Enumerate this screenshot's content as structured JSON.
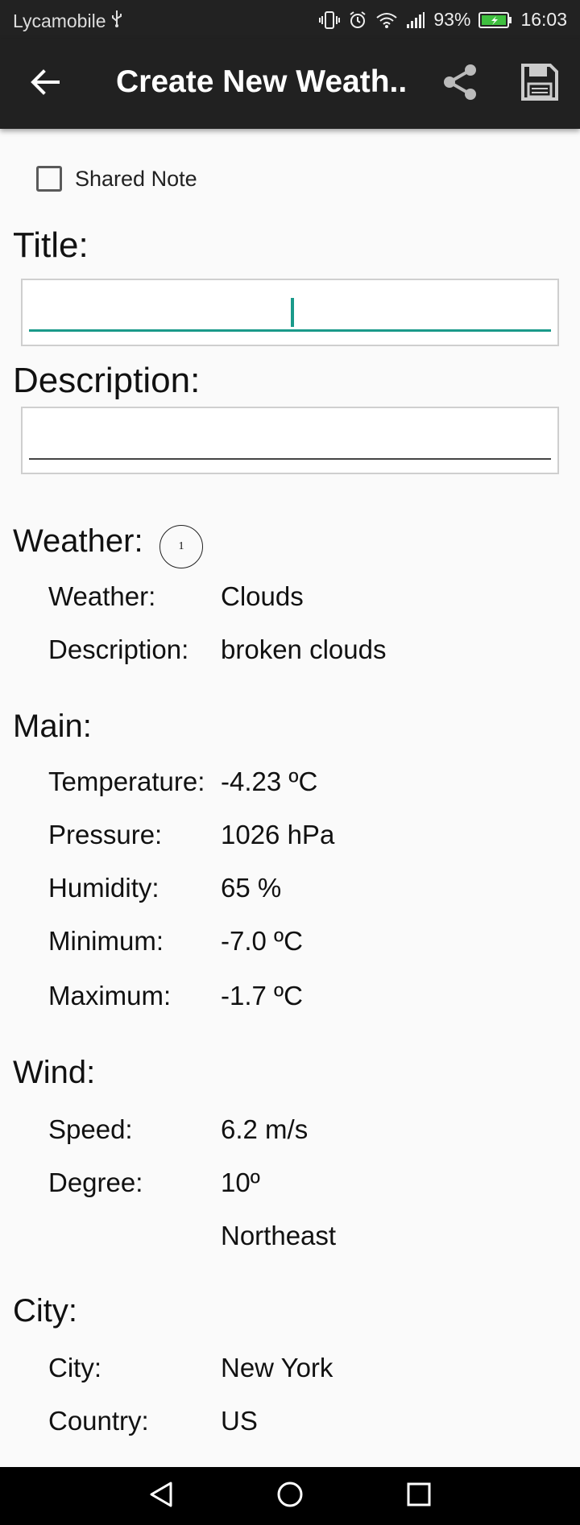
{
  "status_bar": {
    "carrier": "Lycamobile",
    "battery": "93%",
    "time": "16:03"
  },
  "app_bar": {
    "title": "Create New Weath...",
    "icons": [
      "arrow-back-icon",
      "share-icon",
      "save-icon"
    ]
  },
  "shared_note": {
    "label": "Shared Note",
    "checked": false
  },
  "title_field": {
    "label": "Title:",
    "value": ""
  },
  "description_field": {
    "label": "Description:",
    "value": ""
  },
  "weather": {
    "heading": "Weather:",
    "badge": "1",
    "rows": [
      {
        "label": "Weather:",
        "value": "Clouds"
      },
      {
        "label": "Description:",
        "value": "broken clouds"
      }
    ]
  },
  "main": {
    "heading": "Main:",
    "rows": [
      {
        "label": "Temperature:",
        "value": "-4.23 ºC"
      },
      {
        "label": "Pressure:",
        "value": "1026 hPa"
      },
      {
        "label": "Humidity:",
        "value": "65 %"
      },
      {
        "label": "Minimum:",
        "value": "-7.0 ºC"
      },
      {
        "label": "Maximum:",
        "value": "-1.7 ºC"
      }
    ]
  },
  "wind": {
    "heading": "Wind:",
    "rows": [
      {
        "label": "Speed:",
        "value": "6.2 m/s"
      },
      {
        "label": "Degree:",
        "value": "10º"
      },
      {
        "label": "",
        "value": "Northeast"
      }
    ]
  },
  "city": {
    "heading": "City:",
    "rows": [
      {
        "label": "City:",
        "value": "New York"
      },
      {
        "label": "Country:",
        "value": "US"
      }
    ]
  },
  "nav_bar": {
    "icons": [
      "back-triangle-icon",
      "home-circle-icon",
      "recents-square-icon"
    ]
  },
  "colors": {
    "accent": "#1a9a8a",
    "app_bar": "#212121",
    "background": "#fafafa"
  }
}
